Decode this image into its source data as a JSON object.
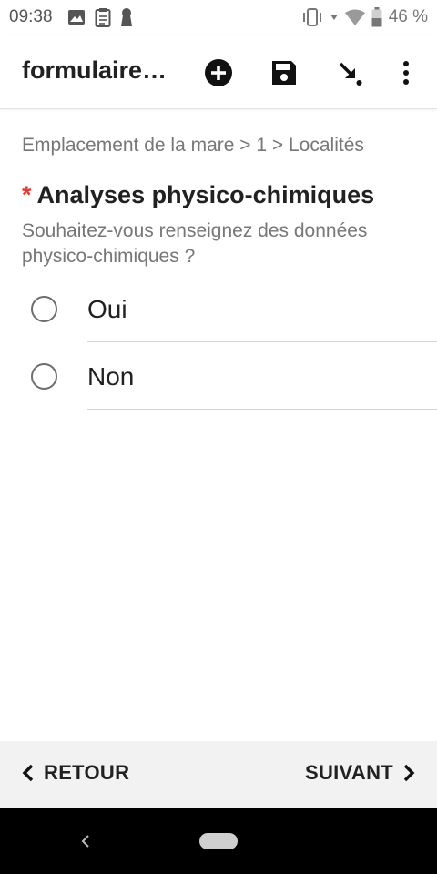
{
  "status_bar": {
    "time": "09:38",
    "battery": "46 %",
    "icons_left": [
      "image-icon",
      "clipboard-icon",
      "keyhole-icon"
    ],
    "icons_right": [
      "vibrate-icon",
      "data-arrow-icon",
      "wifi-icon",
      "battery-icon"
    ]
  },
  "app_bar": {
    "title": "formulaire…",
    "actions": [
      "add-circle-icon",
      "save-icon",
      "goto-icon",
      "more-vert-icon"
    ]
  },
  "breadcrumb": "Emplacement de la mare > 1 > Localités",
  "question": {
    "required_mark": "*",
    "title": "Analyses physico-chimiques",
    "hint": "Souhaitez-vous renseignez des données physico-chimiques ?",
    "options": [
      {
        "label": "Oui",
        "selected": false
      },
      {
        "label": "Non",
        "selected": false
      }
    ]
  },
  "navigation": {
    "back_label": "RETOUR",
    "next_label": "SUIVANT"
  },
  "colors": {
    "required": "#e53935",
    "text_primary": "#212121",
    "text_secondary": "#777777",
    "nav_background": "#f2f2f2"
  }
}
